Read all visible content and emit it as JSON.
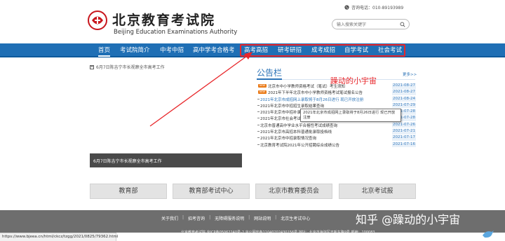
{
  "header": {
    "logo_cn": "北京教育考试院",
    "logo_en": "Beijing Education Examinations Authority",
    "hotline": "咨询电话：010-89193989",
    "search_placeholder": "输入搜索关键字"
  },
  "nav": {
    "items": [
      {
        "label": "首页",
        "active": true
      },
      {
        "label": "考试院简介"
      },
      {
        "label": "中考中招"
      },
      {
        "label": "高中学考合格考"
      },
      {
        "label": "高考高招"
      },
      {
        "label": "研考研招"
      },
      {
        "label": "成考成招"
      },
      {
        "label": "自学考试"
      },
      {
        "label": "社会考试"
      }
    ]
  },
  "left": {
    "news_line": "6月7日陈吉宁市长视察全市高考工作",
    "slide_caption": "6月7日陈吉宁市长视察全市高考工作"
  },
  "notice": {
    "title": "公告栏",
    "more": "更多>>",
    "annotation": "躁动的小宇宙",
    "rows": [
      {
        "text": "北京市中小学教师资格考试（笔试）考生须知",
        "date": "2021-08-27",
        "new": true
      },
      {
        "text": "2021年下半年北京市中小学教师资格考试笔试报名公告",
        "date": "2021-08-27",
        "new": true
      },
      {
        "text": "2021年北京市成招网上录取将于8月26日进行 现已开放注册",
        "date": "2021-08-24",
        "link": true
      },
      {
        "text": "2021年北京市中招招生录取结果查询",
        "date": "2021-07-29"
      },
      {
        "text": "2021年北京市中招补录工作安排",
        "date": "2021-07-28"
      },
      {
        "text": "2021年北京市社会考试考务工作将于7月29日8时开始",
        "date": "2021-07-28"
      },
      {
        "text": "北京市普通高中学业水平合格性考试成绩查询",
        "date": "2021-07-26"
      },
      {
        "text": "2021年北京市高招本科普通批录取投档线",
        "date": "2021-07-21"
      },
      {
        "text": "2021年北京市中招录取情况查询",
        "date": "2021-07-17"
      },
      {
        "text": "北京教育考试院2021年公开招聘综合成绩公告",
        "date": "2021-07-16"
      }
    ],
    "tooltip": "2021年北京市成招网上录取将于8月26日进行 现已开放注册"
  },
  "quick_links": [
    "教育部",
    "教育部考试中心",
    "北京市教育委员会",
    "北京考试报"
  ],
  "footer": {
    "links": [
      "关于我们",
      "招考咨询",
      "无障碍服务说明",
      "网站说明",
      "北京生考试中心"
    ],
    "info": "北京教育考试院 京ICP备05062240号-2 京公网安备11040202430156号 地址：北京市海淀区志新东路9号 邮编：100083",
    "watermark": "知乎 @躁动的小宇宙",
    "status_url": "https://www.bjeea.cn/html/ckcz/tzgg/2021/0825/79362.html"
  },
  "colors": {
    "nav_bg": "#1f6fb5",
    "accent": "#2b73b7",
    "annotation_red": "#e8262a",
    "new_badge": "#ea7a17",
    "footer_bg": "#6e6e6e"
  }
}
